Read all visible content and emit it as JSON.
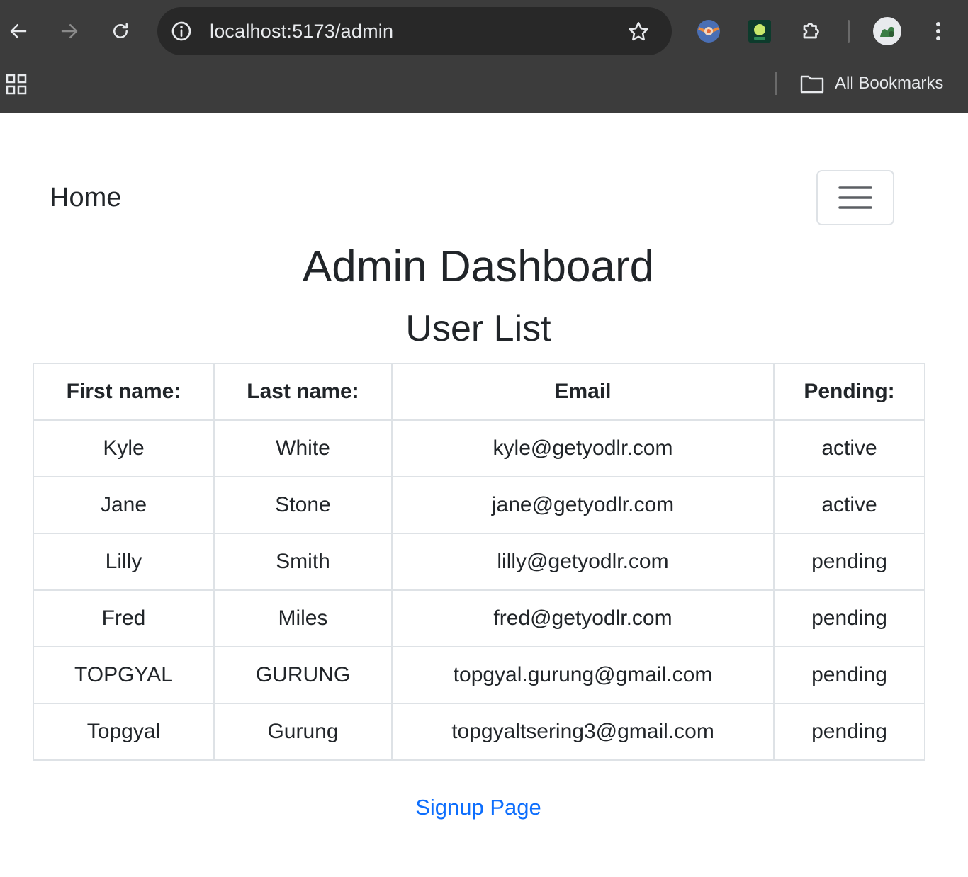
{
  "browser": {
    "url": "localhost:5173/admin",
    "bookmarks_label": "All Bookmarks"
  },
  "navbar": {
    "brand": "Home"
  },
  "page": {
    "title": "Admin Dashboard",
    "subtitle": "User List"
  },
  "table": {
    "headers": {
      "first": "First name:",
      "last": "Last name:",
      "email": "Email",
      "pending": "Pending:"
    },
    "rows": [
      {
        "first": "Kyle",
        "last": "White",
        "email": "kyle@getyodlr.com",
        "status": "active"
      },
      {
        "first": "Jane",
        "last": "Stone",
        "email": "jane@getyodlr.com",
        "status": "active"
      },
      {
        "first": "Lilly",
        "last": "Smith",
        "email": "lilly@getyodlr.com",
        "status": "pending"
      },
      {
        "first": "Fred",
        "last": "Miles",
        "email": "fred@getyodlr.com",
        "status": "pending"
      },
      {
        "first": "TOPGYAL",
        "last": "GURUNG",
        "email": "topgyal.gurung@gmail.com",
        "status": "pending"
      },
      {
        "first": "Topgyal",
        "last": "Gurung",
        "email": "topgyaltsering3@gmail.com",
        "status": "pending"
      }
    ]
  },
  "footer": {
    "signup_link": "Signup Page"
  },
  "colors": {
    "chrome_bg": "#3c3c3c",
    "omnibox_bg": "#282828",
    "link": "#0d6efd",
    "border": "#dee2e6",
    "text": "#212529"
  },
  "icons": [
    "back-arrow-icon",
    "forward-arrow-icon",
    "reload-icon",
    "site-info-icon",
    "bookmark-star-icon",
    "extension-icon",
    "puzzle-extensions-icon",
    "profile-avatar-icon",
    "kebab-menu-icon",
    "apps-grid-icon",
    "folder-icon",
    "hamburger-icon"
  ]
}
